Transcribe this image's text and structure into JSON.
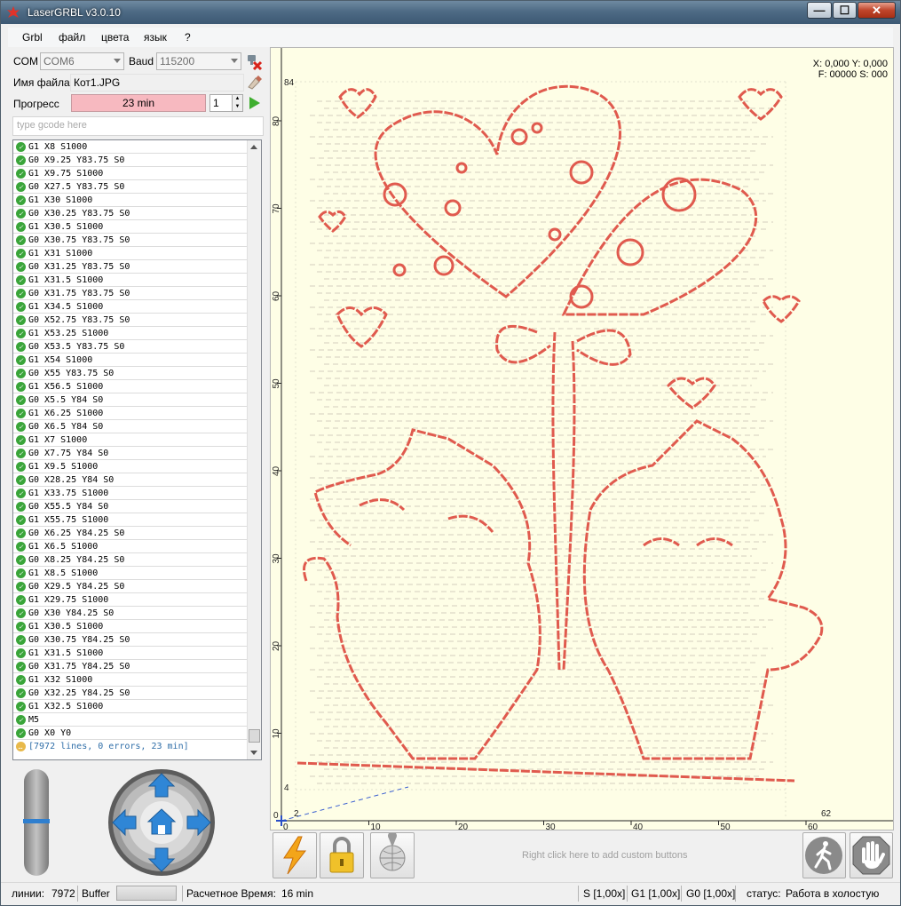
{
  "window": {
    "title": "LaserGRBL v3.0.10",
    "minimize_label": "—",
    "maximize_label": "☐",
    "close_label": "✕"
  },
  "menu": [
    "Grbl",
    "файл",
    "цвета",
    "язык",
    "?"
  ],
  "connection": {
    "com_label": "COM",
    "com_value": "COM6",
    "baud_label": "Baud",
    "baud_value": "115200"
  },
  "file": {
    "label": "Имя файла",
    "value": "Кот1.JPG"
  },
  "progress": {
    "label": "Прогресс",
    "text": "23 min",
    "repeat_count": "1"
  },
  "gcode_input": {
    "placeholder": "type gcode here"
  },
  "gcode_lines": [
    "G1 X8 S1000",
    "G0 X9.25 Y83.75 S0",
    "G1 X9.75 S1000",
    "G0 X27.5 Y83.75 S0",
    "G1 X30 S1000",
    "G0 X30.25 Y83.75 S0",
    "G1 X30.5 S1000",
    "G0 X30.75 Y83.75 S0",
    "G1 X31 S1000",
    "G0 X31.25 Y83.75 S0",
    "G1 X31.5 S1000",
    "G0 X31.75 Y83.75 S0",
    "G1 X34.5 S1000",
    "G0 X52.75 Y83.75 S0",
    "G1 X53.25 S1000",
    "G0 X53.5 Y83.75 S0",
    "G1 X54 S1000",
    "G0 X55 Y83.75 S0",
    "G1 X56.5 S1000",
    "G0 X5.5 Y84 S0",
    "G1 X6.25 S1000",
    "G0 X6.5 Y84 S0",
    "G1 X7 S1000",
    "G0 X7.75 Y84 S0",
    "G1 X9.5 S1000",
    "G0 X28.25 Y84 S0",
    "G1 X33.75 S1000",
    "G0 X55.5 Y84 S0",
    "G1 X55.75 S1000",
    "G0 X6.25 Y84.25 S0",
    "G1 X6.5 S1000",
    "G0 X8.25 Y84.25 S0",
    "G1 X8.5 S1000",
    "G0 X29.5 Y84.25 S0",
    "G1 X29.75 S1000",
    "G0 X30 Y84.25 S0",
    "G1 X30.5 S1000",
    "G0 X30.75 Y84.25 S0",
    "G1 X31.5 S1000",
    "G0 X31.75 Y84.25 S0",
    "G1 X32 S1000",
    "G0 X32.25 Y84.25 S0",
    "G1 X32.5 S1000",
    "M5",
    "G0 X0 Y0"
  ],
  "gcode_summary": "[7972 lines, 0 errors, 23 min]",
  "canvas": {
    "coord_line1": "X: 0,000 Y: 0,000",
    "coord_line2": "F: 00000 S: 000",
    "x_ticks": [
      "0",
      "10",
      "20",
      "30",
      "40",
      "50",
      "60"
    ],
    "y_ticks": [
      "10",
      "20",
      "30",
      "40",
      "50",
      "60",
      "70",
      "80"
    ],
    "y_top_marker": "84",
    "y_bottom_marker": "4",
    "x_left_marker": "2",
    "x_right_marker": "62",
    "origin_label": "0",
    "line_color": "#e05a4e",
    "background_color": "#fefee6"
  },
  "toolbar": {
    "hint": "Right click here to add custom buttons",
    "buttons": [
      "lightning-icon",
      "lock-icon",
      "globe-pin-icon",
      "walk-icon",
      "stop-hand-icon"
    ]
  },
  "status": {
    "lines_label": "линии:",
    "lines_value": "7972",
    "buffer_label": "Buffer",
    "est_label": "Расчетное Время:",
    "est_value": "16 min",
    "s_override": "S [1,00x]",
    "g1_override": "G1 [1,00x]",
    "g0_override": "G0 [1,00x]",
    "state_label": "статус:",
    "state_value": "Работа в холостую"
  }
}
